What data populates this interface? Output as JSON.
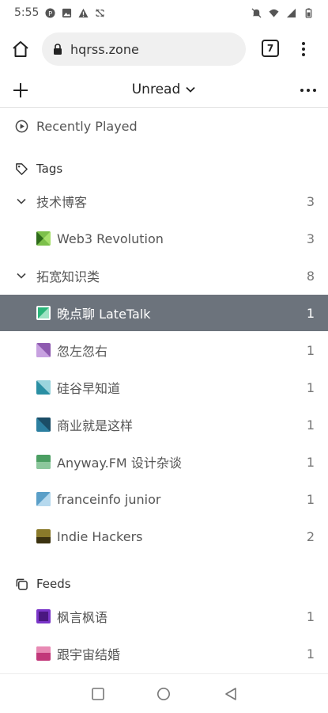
{
  "status_bar": {
    "time": "5:55"
  },
  "browser": {
    "url": "hqrss.zone",
    "tab_count": "7"
  },
  "header": {
    "filter_label": "Unread"
  },
  "recently_played": {
    "label": "Recently Played"
  },
  "tags_section": {
    "label": "Tags"
  },
  "groups": [
    {
      "name": "技术博客",
      "count": "3",
      "items": [
        {
          "name": "Web3 Revolution",
          "count": "3",
          "color": "#7cc04a"
        }
      ]
    },
    {
      "name": "拓宽知识类",
      "count": "8",
      "items": [
        {
          "name": "晚点聊 LateTalk",
          "count": "1",
          "color": "#2bb57a"
        },
        {
          "name": "忽左忽右",
          "count": "1",
          "color": "#8e5ab0"
        },
        {
          "name": "硅谷早知道",
          "count": "1",
          "color": "#2a8fa3"
        },
        {
          "name": "商业就是这样",
          "count": "1",
          "color": "#2c7fa0"
        },
        {
          "name": "Anyway.FM 设计杂谈",
          "count": "1",
          "color": "#4b9e62"
        },
        {
          "name": "franceinfo junior",
          "count": "1",
          "color": "#5a9fc8"
        },
        {
          "name": "Indie Hackers",
          "count": "2",
          "color": "#8a7a2a"
        }
      ]
    }
  ],
  "feeds_section": {
    "label": "Feeds",
    "items": [
      {
        "name": "枫言枫语",
        "count": "1",
        "color": "#7a35c8"
      },
      {
        "name": "跟宇宙结婚",
        "count": "1",
        "color": "#c2387a"
      }
    ]
  }
}
